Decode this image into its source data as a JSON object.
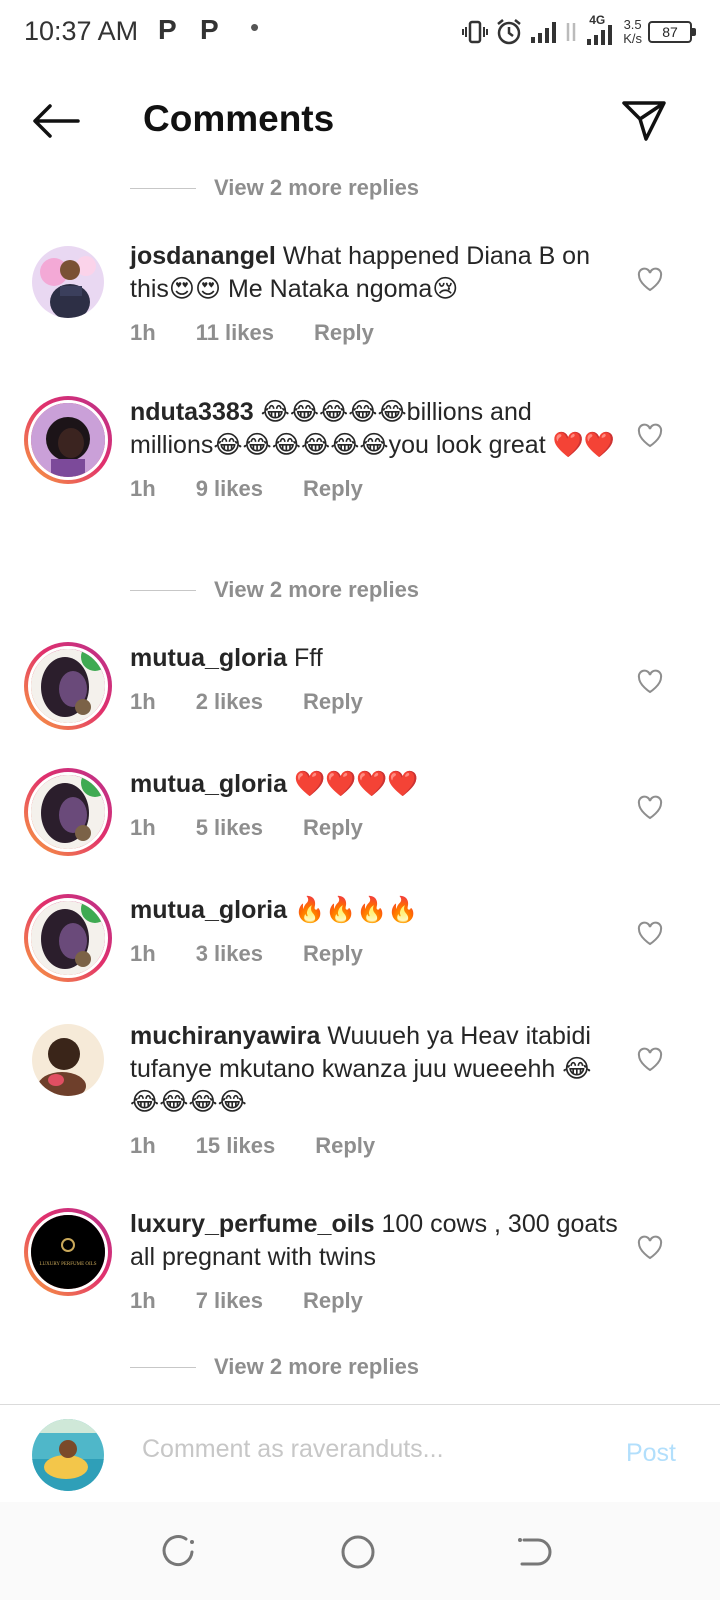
{
  "status_bar": {
    "time": "10:37 AM",
    "p1": "P",
    "p2": "P",
    "dot": "•",
    "network": "4G",
    "speed_value": "3.5",
    "speed_unit": "K/s",
    "battery": "87"
  },
  "header": {
    "title": "Comments"
  },
  "view_replies": [
    {
      "label": "View 2 more replies"
    },
    {
      "label": "View 2 more replies"
    },
    {
      "label": "View 2 more replies"
    }
  ],
  "comments": [
    {
      "username": "josdanangel",
      "text": "What happened Diana B on this😍😍 Me Nataka ngoma😢",
      "time": "1h",
      "likes": "11 likes",
      "reply": "Reply"
    },
    {
      "username": "nduta3383",
      "text": "😂😂😂😂😂billions and millions😂😂😂😂😂😂you look great ❤️❤️",
      "time": "1h",
      "likes": "9 likes",
      "reply": "Reply"
    },
    {
      "username": "mutua_gloria",
      "text": "Fff",
      "time": "1h",
      "likes": "2 likes",
      "reply": "Reply"
    },
    {
      "username": "mutua_gloria",
      "text": "❤️❤️❤️❤️",
      "time": "1h",
      "likes": "5 likes",
      "reply": "Reply"
    },
    {
      "username": "mutua_gloria",
      "text": "🔥🔥🔥🔥",
      "time": "1h",
      "likes": "3 likes",
      "reply": "Reply"
    },
    {
      "username": "muchiranyawira",
      "text": "Wuuueh ya Heav itabidi tufanye mkutano kwanza juu wueeehh 😂😂😂😂😂",
      "time": "1h",
      "likes": "15 likes",
      "reply": "Reply"
    },
    {
      "username": "luxury_perfume_oils",
      "text": "100 cows , 300 goats all pregnant with twins",
      "time": "1h",
      "likes": "7 likes",
      "reply": "Reply"
    }
  ],
  "avatars": {
    "luxury_logo_text": "LUXURY PERFUME OILS"
  },
  "compose": {
    "placeholder": "Comment as raveranduts...",
    "post_label": "Post"
  },
  "colors": {
    "accent_post_disabled": "#b2dffc",
    "ring_gradient_start": "#f9a23d",
    "ring_gradient_end": "#b7318e"
  }
}
